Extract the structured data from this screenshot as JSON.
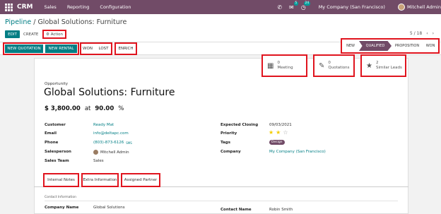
{
  "navbar": {
    "brand": "CRM",
    "menu": [
      "Sales",
      "Reporting",
      "Configuration"
    ],
    "msg_count": "5",
    "activity_count": "24",
    "company": "My Company (San Francisco)",
    "user": "Mitchell Admin"
  },
  "breadcrumb": {
    "parent": "Pipeline",
    "sep": " / ",
    "current": "Global Solutions: Furniture"
  },
  "toolbar": {
    "edit": "EDIT",
    "create": "CREATE",
    "action": "⚙ Action"
  },
  "pager": {
    "value": "5 / 18",
    "prev": "‹",
    "next": "›"
  },
  "actions": {
    "new_quotation": "NEW QUOTATION",
    "new_rental": "NEW RENTAL",
    "won": "WON",
    "lost": "LOST",
    "enrich": "ENRICH"
  },
  "stages": [
    {
      "label": "NEW",
      "active": false
    },
    {
      "label": "QUALIFIED",
      "active": true
    },
    {
      "label": "PROPOSITION",
      "active": false
    },
    {
      "label": "WON",
      "active": false
    }
  ],
  "smart_buttons": {
    "meeting": {
      "count": "0",
      "label": "Meeting"
    },
    "quotations": {
      "count": "0",
      "label": "Quotations"
    },
    "similar": {
      "count": "2",
      "label": "Similar Leads"
    }
  },
  "record": {
    "type_label": "Opportunity",
    "name": "Global Solutions: Furniture",
    "revenue": "$ 3,800.00",
    "at": "at",
    "probability": "90.00",
    "pct": "%"
  },
  "left_fields": [
    {
      "label": "Customer",
      "value": "Ready Mat"
    },
    {
      "label": "Email",
      "value": "info@deltapc.com"
    },
    {
      "label": "Phone",
      "value": "(803)-873-6126",
      "extra": "SMS"
    },
    {
      "label": "Salesperson",
      "value": "Mitchell Admin"
    },
    {
      "label": "Sales Team",
      "value": "Sales"
    }
  ],
  "right_fields": [
    {
      "label": "Expected Closing",
      "value": "09/03/2021"
    },
    {
      "label": "Priority",
      "value": ""
    },
    {
      "label": "Tags",
      "value": "Design"
    },
    {
      "label": "Company",
      "value": "My Company (San Francisco)"
    }
  ],
  "priority": {
    "stars_filled": 2,
    "stars_total": 3
  },
  "tabs": [
    "Internal Notes",
    "Extra Information",
    "Assigned Partner"
  ],
  "extra": {
    "section_title": "Contact Information",
    "company_name_label": "Company Name",
    "company_name_value": "Global Solutions",
    "contact_name_label": "Contact Name",
    "contact_name_value": "Robin Smith"
  },
  "colors": {
    "brand": "#714B67",
    "primary": "#017e84",
    "highlight": "#e0141e"
  }
}
